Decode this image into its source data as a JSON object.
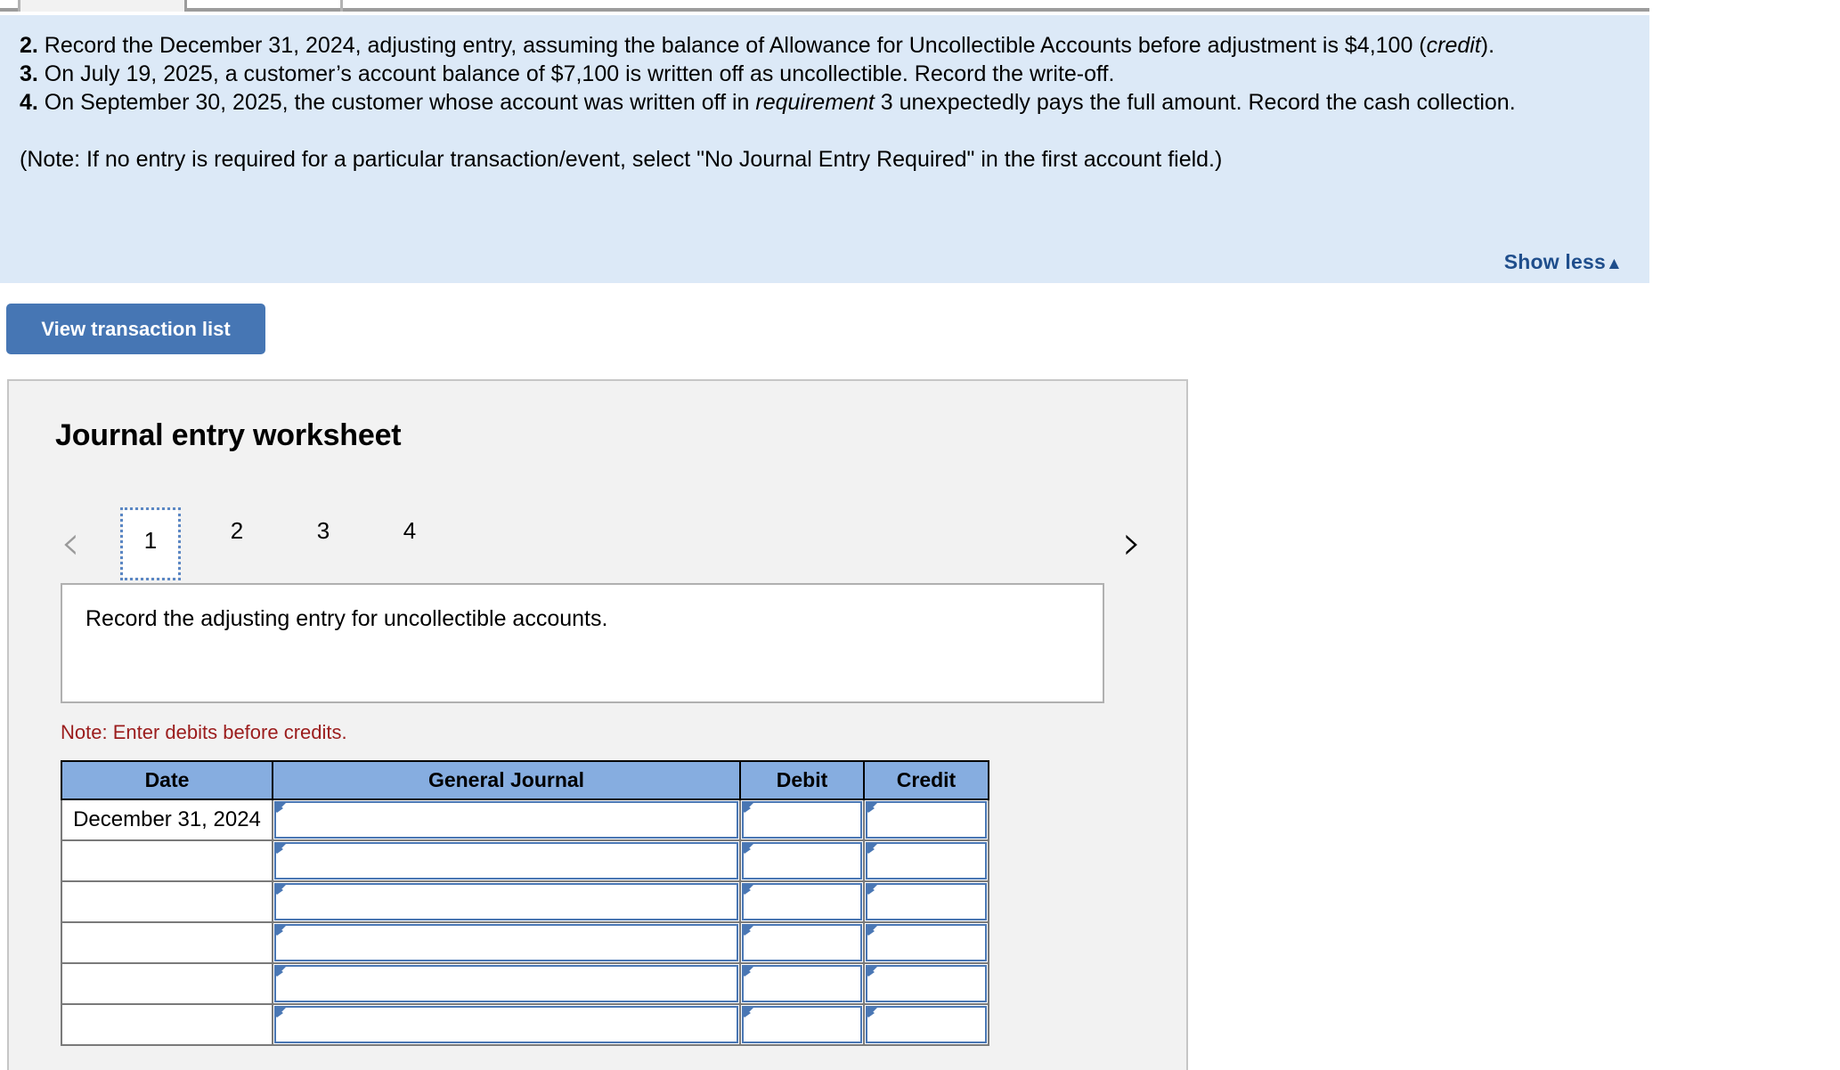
{
  "tabstrip": {
    "tab1_label": "",
    "tab2_label": ""
  },
  "instructions": {
    "item2_num": "2.",
    "item2_text": " Record the December 31, 2024, adjusting entry, assuming the balance of Allowance for Uncollectible Accounts before adjustment is $4,100 (",
    "item2_italic": "credit",
    "item2_tail": ").",
    "item3_num": "3.",
    "item3_text": " On July 19, 2025, a customer’s account balance of $7,100 is written off as uncollectible. Record the write-off.",
    "item4_num": "4.",
    "item4_text": " On September 30, 2025, the customer whose account was written off in ",
    "item4_italic": "requirement",
    "item4_tail": " 3 unexpectedly pays the full amount. Record the cash collection.",
    "note": "(Note: If no entry is required for a particular transaction/event, select \"No Journal Entry Required\" in the first account field.)",
    "show_less_label": "Show less",
    "show_less_caret": "▲"
  },
  "toolbar": {
    "view_transaction_list_label": "View transaction list"
  },
  "worksheet": {
    "title": "Journal entry worksheet",
    "prev_icon": "‹",
    "next_icon": "›",
    "pages": [
      "1",
      "2",
      "3",
      "4"
    ],
    "active_page": "1",
    "description": "Record the adjusting entry for uncollectible accounts.",
    "debits_note": "Note: Enter debits before credits.",
    "table": {
      "headers": [
        "Date",
        "General Journal",
        "Debit",
        "Credit"
      ],
      "rows": [
        {
          "date": "December 31, 2024",
          "general_journal": "",
          "debit": "",
          "credit": ""
        },
        {
          "date": "",
          "general_journal": "",
          "debit": "",
          "credit": ""
        },
        {
          "date": "",
          "general_journal": "",
          "debit": "",
          "credit": ""
        },
        {
          "date": "",
          "general_journal": "",
          "debit": "",
          "credit": ""
        },
        {
          "date": "",
          "general_journal": "",
          "debit": "",
          "credit": ""
        },
        {
          "date": "",
          "general_journal": "",
          "debit": "",
          "credit": ""
        }
      ]
    }
  },
  "colors": {
    "panel_bg": "#dce9f7",
    "accent_blue": "#4676b4",
    "link_navy": "#1f4e8c",
    "alert_red": "#9b1c1c",
    "table_header_blue": "#86ade0",
    "card_bg": "#f2f2f2"
  }
}
